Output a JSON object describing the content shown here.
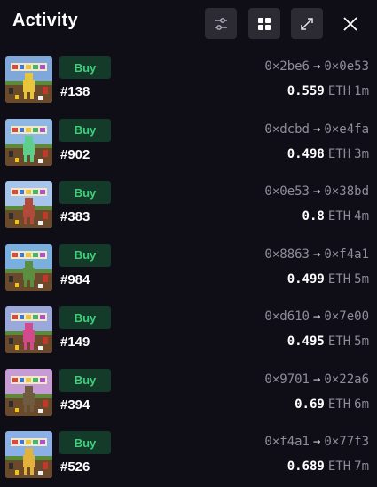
{
  "header": {
    "title": "Activity"
  },
  "icons": {
    "filter": "filter-sliders-icon",
    "grid": "grid-view-icon",
    "expand": "expand-icon",
    "close": "close-icon"
  },
  "colors": {
    "background": "#0f0e17",
    "button_bg": "#2c2b33",
    "buy_badge_bg": "#143a29",
    "buy_badge_text": "#3fd17a",
    "muted_text": "#8f8d98"
  },
  "activity": [
    {
      "type": "Buy",
      "token_id": "#138",
      "from": "0×2be6",
      "to": "0×0e53",
      "price": "0.559",
      "unit": "ETH",
      "time": "1m",
      "nft_body": "#e8c53a",
      "nft_sky": "#7fa7d9"
    },
    {
      "type": "Buy",
      "token_id": "#902",
      "from": "0×dcbd",
      "to": "0×e4fa",
      "price": "0.498",
      "unit": "ETH",
      "time": "3m",
      "nft_body": "#5ecf8a",
      "nft_sky": "#8fb7e3"
    },
    {
      "type": "Buy",
      "token_id": "#383",
      "from": "0×0e53",
      "to": "0×38bd",
      "price": "0.8",
      "unit": "ETH",
      "time": "4m",
      "nft_body": "#b04a3a",
      "nft_sky": "#a7c4ea"
    },
    {
      "type": "Buy",
      "token_id": "#984",
      "from": "0×8863",
      "to": "0×f4a1",
      "price": "0.499",
      "unit": "ETH",
      "time": "5m",
      "nft_body": "#5b8f3f",
      "nft_sky": "#79b0e0"
    },
    {
      "type": "Buy",
      "token_id": "#149",
      "from": "0×d610",
      "to": "0×7e00",
      "price": "0.495",
      "unit": "ETH",
      "time": "5m",
      "nft_body": "#d14a8b",
      "nft_sky": "#9aa8dc"
    },
    {
      "type": "Buy",
      "token_id": "#394",
      "from": "0×9701",
      "to": "0×22a6",
      "price": "0.69",
      "unit": "ETH",
      "time": "6m",
      "nft_body": "#6f5b3e",
      "nft_sky": "#c79bd3"
    },
    {
      "type": "Buy",
      "token_id": "#526",
      "from": "0×f4a1",
      "to": "0×77f3",
      "price": "0.689",
      "unit": "ETH",
      "time": "7m",
      "nft_body": "#e3b23c",
      "nft_sky": "#8ab0e6"
    }
  ]
}
